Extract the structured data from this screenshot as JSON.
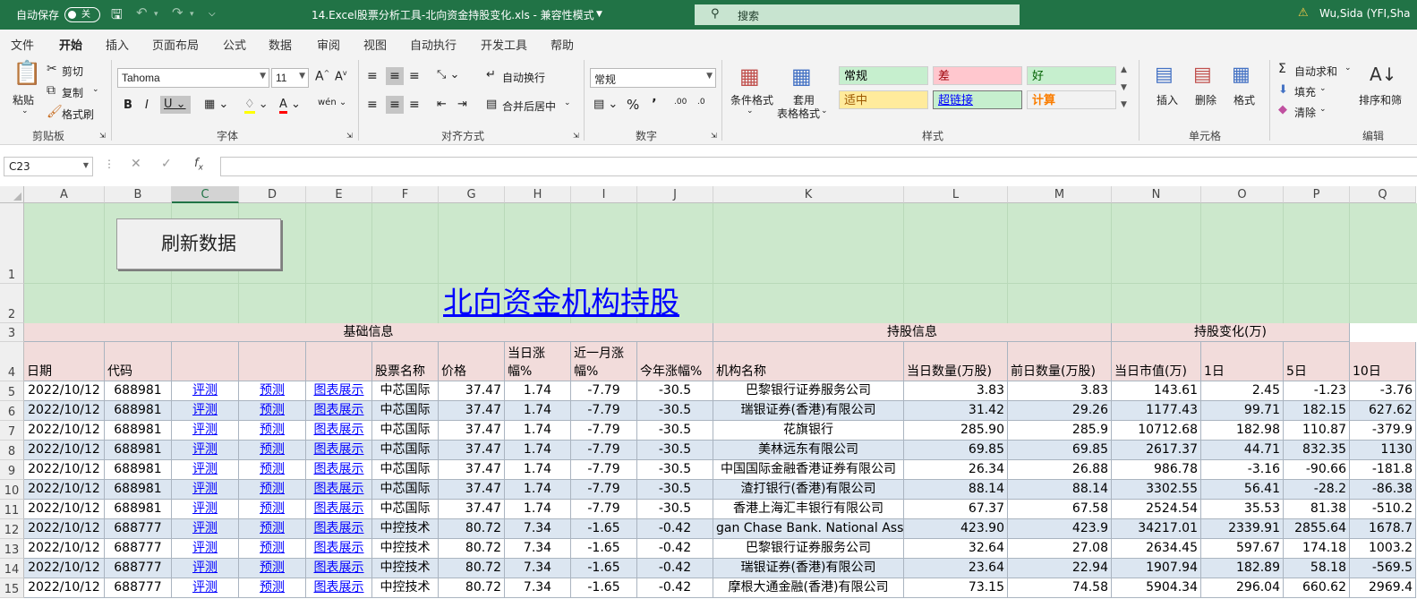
{
  "titlebar": {
    "autosave_label": "自动保存",
    "autosave_state": "关",
    "file_title": "14.Excel股票分析工具-北向资金持股变化.xls  -  兼容性模式",
    "search_placeholder": "搜索",
    "user": "Wu,Sida (YFI,Sha"
  },
  "menu_tabs": [
    "文件",
    "开始",
    "插入",
    "页面布局",
    "公式",
    "数据",
    "审阅",
    "视图",
    "自动执行",
    "开发工具",
    "帮助"
  ],
  "ribbon": {
    "clipboard": {
      "paste": "粘贴",
      "cut": "剪切",
      "copy": "复制",
      "format_painter": "格式刷",
      "group": "剪贴板"
    },
    "font": {
      "name": "Tahoma",
      "size": "11",
      "group": "字体"
    },
    "alignment": {
      "wrap": "自动换行",
      "merge": "合并后居中",
      "group": "对齐方式"
    },
    "number": {
      "format": "常规",
      "group": "数字"
    },
    "styles": {
      "conditional": "条件格式",
      "table_format_1": "套用",
      "table_format_2": "表格格式",
      "group": "样式",
      "cells": [
        {
          "label": "常规",
          "bg": "#c6efce",
          "fg": "#000000"
        },
        {
          "label": "差",
          "bg": "#ffc7ce",
          "fg": "#9c0006"
        },
        {
          "label": "好",
          "bg": "#c6efce",
          "fg": "#006100"
        },
        {
          "label": "适中",
          "bg": "#ffeb9c",
          "fg": "#9c5700"
        },
        {
          "label": "超链接",
          "bg": "#c6efce",
          "fg": "#0000ff"
        },
        {
          "label": "计算",
          "bg": "#f2f2f2",
          "fg": "#fa7d00"
        }
      ]
    },
    "cells_group": {
      "insert": "插入",
      "delete": "删除",
      "format": "格式",
      "group": "单元格"
    },
    "editing": {
      "autosum": "自动求和",
      "fill": "填充",
      "clear": "清除",
      "sort": "排序和筛",
      "group": "编辑"
    }
  },
  "formula_bar": {
    "name_box": "C23",
    "formula": ""
  },
  "columns": [
    "A",
    "B",
    "C",
    "D",
    "E",
    "F",
    "G",
    "H",
    "I",
    "J",
    "K",
    "L",
    "M",
    "N",
    "O",
    "P",
    "Q"
  ],
  "selected_column": "C",
  "sheet": {
    "button_label": "刷新数据",
    "title_link": "北向资金机构持股",
    "section_headers": [
      "基础信息",
      "持股信息",
      "持股变化(万)"
    ],
    "headers": [
      "日期",
      "代码",
      "",
      "",
      "",
      "股票名称",
      "价格",
      "当日涨幅%",
      "近一月涨幅%",
      "今年涨幅%",
      "机构名称",
      "当日数量(万股)",
      "前日数量(万股)",
      "当日市值(万)",
      "1日",
      "5日",
      "10日"
    ],
    "link_labels": [
      "评测",
      "预测",
      "图表展示"
    ],
    "rows": [
      {
        "row": "5",
        "date": "2022/10/12",
        "code": "688981",
        "name": "中芯国际",
        "price": "37.47",
        "day": "1.74",
        "month": "-7.79",
        "year": "-30.5",
        "inst": "巴黎银行证券服务公司",
        "qty": "3.83",
        "prev": "3.83",
        "mv": "143.61",
        "d1": "2.45",
        "d5": "-1.23",
        "d10": "-3.76"
      },
      {
        "row": "6",
        "date": "2022/10/12",
        "code": "688981",
        "name": "中芯国际",
        "price": "37.47",
        "day": "1.74",
        "month": "-7.79",
        "year": "-30.5",
        "inst": "瑞银证券(香港)有限公司",
        "qty": "31.42",
        "prev": "29.26",
        "mv": "1177.43",
        "d1": "99.71",
        "d5": "182.15",
        "d10": "627.62"
      },
      {
        "row": "7",
        "date": "2022/10/12",
        "code": "688981",
        "name": "中芯国际",
        "price": "37.47",
        "day": "1.74",
        "month": "-7.79",
        "year": "-30.5",
        "inst": "花旗银行",
        "qty": "285.90",
        "prev": "285.9",
        "mv": "10712.68",
        "d1": "182.98",
        "d5": "110.87",
        "d10": "-379.9"
      },
      {
        "row": "8",
        "date": "2022/10/12",
        "code": "688981",
        "name": "中芯国际",
        "price": "37.47",
        "day": "1.74",
        "month": "-7.79",
        "year": "-30.5",
        "inst": "美林远东有限公司",
        "qty": "69.85",
        "prev": "69.85",
        "mv": "2617.37",
        "d1": "44.71",
        "d5": "832.35",
        "d10": "1130"
      },
      {
        "row": "9",
        "date": "2022/10/12",
        "code": "688981",
        "name": "中芯国际",
        "price": "37.47",
        "day": "1.74",
        "month": "-7.79",
        "year": "-30.5",
        "inst": "中国国际金融香港证券有限公司",
        "qty": "26.34",
        "prev": "26.88",
        "mv": "986.78",
        "d1": "-3.16",
        "d5": "-90.66",
        "d10": "-181.8"
      },
      {
        "row": "10",
        "date": "2022/10/12",
        "code": "688981",
        "name": "中芯国际",
        "price": "37.47",
        "day": "1.74",
        "month": "-7.79",
        "year": "-30.5",
        "inst": "渣打银行(香港)有限公司",
        "qty": "88.14",
        "prev": "88.14",
        "mv": "3302.55",
        "d1": "56.41",
        "d5": "-28.2",
        "d10": "-86.38"
      },
      {
        "row": "11",
        "date": "2022/10/12",
        "code": "688981",
        "name": "中芯国际",
        "price": "37.47",
        "day": "1.74",
        "month": "-7.79",
        "year": "-30.5",
        "inst": "香港上海汇丰银行有限公司",
        "qty": "67.37",
        "prev": "67.58",
        "mv": "2524.54",
        "d1": "35.53",
        "d5": "81.38",
        "d10": "-510.2"
      },
      {
        "row": "12",
        "date": "2022/10/12",
        "code": "688777",
        "name": "中控技术",
        "price": "80.72",
        "day": "7.34",
        "month": "-1.65",
        "year": "-0.42",
        "inst": "gan Chase Bank. National Asso",
        "qty": "423.90",
        "prev": "423.9",
        "mv": "34217.01",
        "d1": "2339.91",
        "d5": "2855.64",
        "d10": "1678.7"
      },
      {
        "row": "13",
        "date": "2022/10/12",
        "code": "688777",
        "name": "中控技术",
        "price": "80.72",
        "day": "7.34",
        "month": "-1.65",
        "year": "-0.42",
        "inst": "巴黎银行证券服务公司",
        "qty": "32.64",
        "prev": "27.08",
        "mv": "2634.45",
        "d1": "597.67",
        "d5": "174.18",
        "d10": "1003.2"
      },
      {
        "row": "14",
        "date": "2022/10/12",
        "code": "688777",
        "name": "中控技术",
        "price": "80.72",
        "day": "7.34",
        "month": "-1.65",
        "year": "-0.42",
        "inst": "瑞银证券(香港)有限公司",
        "qty": "23.64",
        "prev": "22.94",
        "mv": "1907.94",
        "d1": "182.89",
        "d5": "58.18",
        "d10": "-569.5"
      },
      {
        "row": "15",
        "date": "2022/10/12",
        "code": "688777",
        "name": "中控技术",
        "price": "80.72",
        "day": "7.34",
        "month": "-1.65",
        "year": "-0.42",
        "inst": "摩根大通金融(香港)有限公司",
        "qty": "73.15",
        "prev": "74.58",
        "mv": "5904.34",
        "d1": "296.04",
        "d5": "660.62",
        "d10": "2969.4"
      }
    ]
  },
  "colors": {
    "excel_green": "#217346",
    "sheet_green": "#cce8cc",
    "header_pink": "#f2dcdb",
    "row_blue": "#dce6f1",
    "link_blue": "#0000ff"
  }
}
